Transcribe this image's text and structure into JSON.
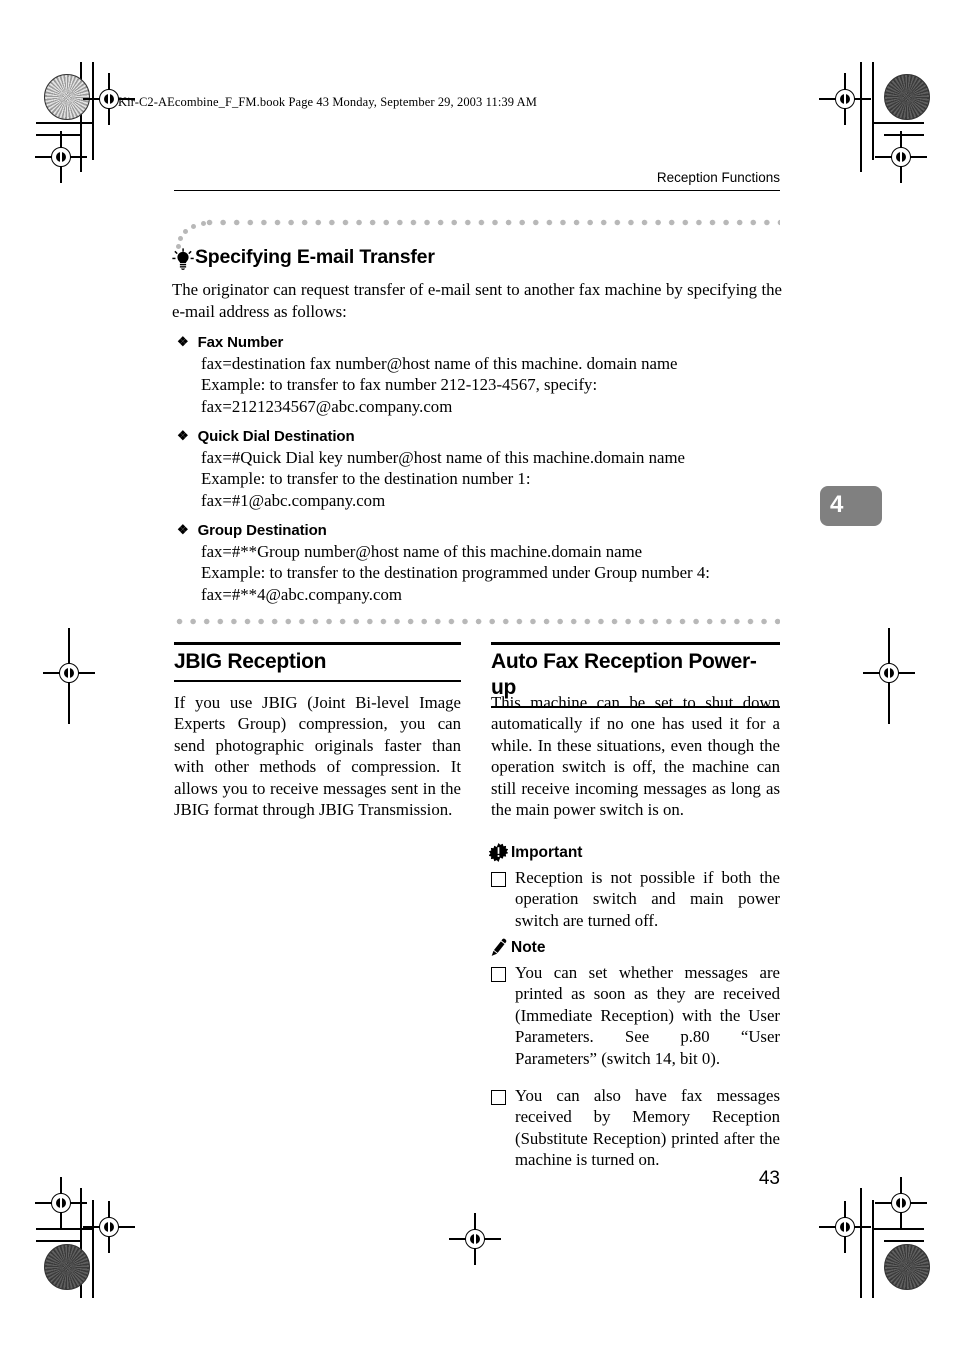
{
  "print_marks": {
    "file_line": "Kir-C2-AEcombine_F_FM.book  Page 43  Monday, September 29, 2003  11:39 AM"
  },
  "header": {
    "running_head": "Reception Functions"
  },
  "chapter_tab": {
    "number": "4",
    "bg_color": "#808080",
    "text_color": "#ffffff"
  },
  "tip_section": {
    "icon": "lightbulb-icon",
    "title": "Specifying E-mail Transfer",
    "intro": "The originator can request transfer of e-mail sent to another fax machine by specifying the e-mail address as follows:",
    "blocks": [
      {
        "bullet": "❖",
        "heading": "Fax Number",
        "lines": [
          "fax=destination fax number@host name of this machine. domain name",
          "Example: to transfer to fax number 212-123-4567, specify:",
          "fax=2121234567@abc.company.com"
        ]
      },
      {
        "bullet": "❖",
        "heading": "Quick Dial Destination",
        "lines": [
          "fax=#Quick Dial key number@host name of this machine.domain name",
          "Example: to transfer to the destination number 1:",
          "fax=#1@abc.company.com"
        ]
      },
      {
        "bullet": "❖",
        "heading": "Group Destination",
        "lines": [
          "fax=#**Group number@host name of this machine.domain name",
          "Example: to transfer to the destination programmed under Group number 4:",
          "fax=#**4@abc.company.com"
        ]
      }
    ]
  },
  "columns": {
    "left": {
      "title": "JBIG Reception",
      "body": "If you use JBIG (Joint Bi-level Image Experts Group) compression, you can send photographic originals faster than with other methods of compression. It allows you to receive messages sent in the JBIG format through JBIG Transmission."
    },
    "right": {
      "title": "Auto Fax Reception Power-up",
      "body": "This machine can be set to shut down automatically if no one has used it for a while. In these situations, even though the operation switch is off, the machine can still receive incoming messages as long as the main power switch is on.",
      "important": {
        "icon": "important-starburst-icon",
        "label": "Important",
        "items": [
          "Reception is not possible if both the operation switch and main power switch are turned off."
        ]
      },
      "note": {
        "icon": "pencil-note-icon",
        "label": "Note",
        "items": [
          "You can set whether messages are printed as soon as they are received (Immediate Reception) with the User Parameters. See p.80 “User Parameters” (switch 14, bit 0).",
          "You can also have fax messages received by Memory Reception (Substitute Reception) printed after the machine is turned on."
        ]
      }
    }
  },
  "footer": {
    "page_number": "43"
  }
}
